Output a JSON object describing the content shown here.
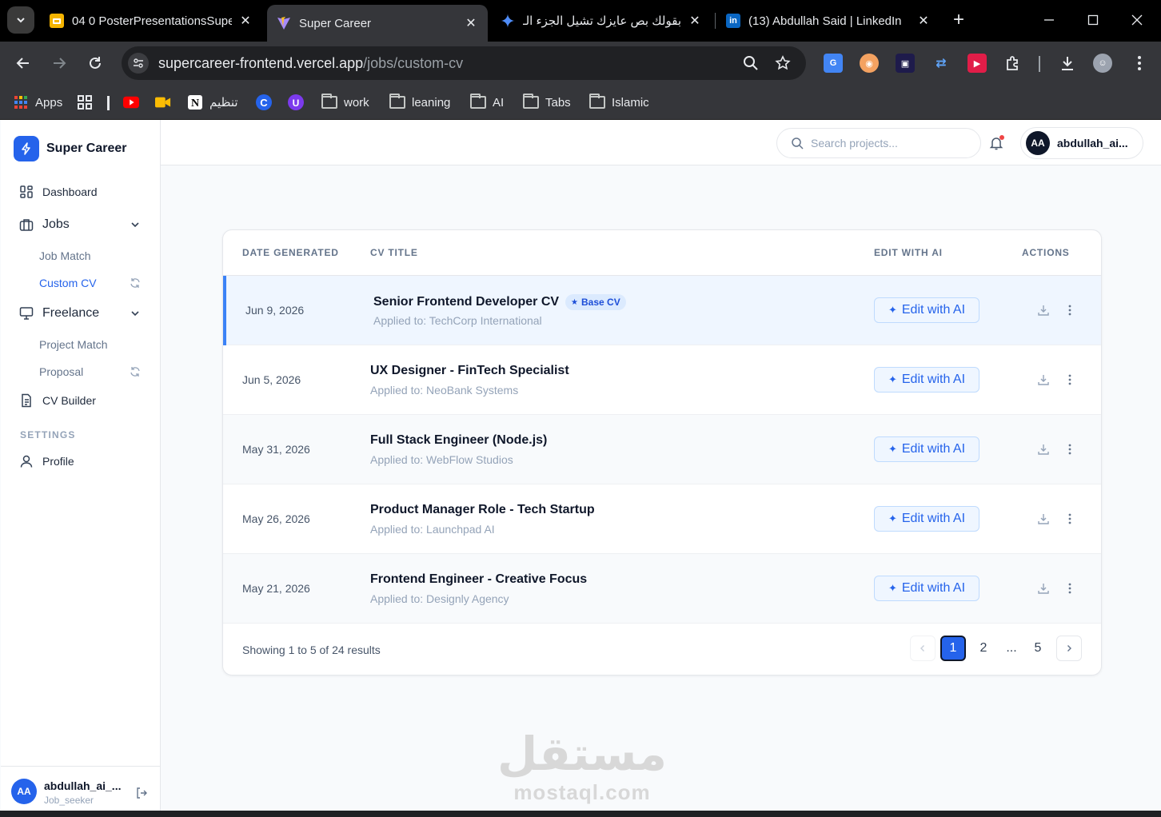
{
  "browser": {
    "tabs": [
      {
        "title": "04 0 PosterPresentationsSupe",
        "icon": "slides-icon"
      },
      {
        "title": "Super Career",
        "icon": "vite-icon",
        "active": true
      },
      {
        "title": "بقولك بص عايزك تشيل الجزء الـ",
        "icon": "gemini-icon"
      },
      {
        "title": "(13) Abdullah Said | LinkedIn",
        "icon": "linkedin-icon"
      }
    ],
    "url_host": "supercareer-frontend.vercel.app",
    "url_path": "/jobs/custom-cv",
    "bookmarks": [
      {
        "label": "Apps",
        "icon": "apps-grid-icon"
      },
      {
        "label": "",
        "icon": "youtube-icon"
      },
      {
        "label": "",
        "icon": "meet-icon"
      },
      {
        "label": "تنظيم",
        "icon": "notion-icon"
      },
      {
        "label": "",
        "icon": "c-app-icon"
      },
      {
        "label": "",
        "icon": "u-app-icon"
      },
      {
        "label": "work",
        "icon": "folder-icon"
      },
      {
        "label": "leaning",
        "icon": "folder-icon"
      },
      {
        "label": "AI",
        "icon": "folder-icon"
      },
      {
        "label": "Tabs",
        "icon": "folder-icon"
      },
      {
        "label": "Islamic",
        "icon": "folder-icon"
      }
    ]
  },
  "app": {
    "brand": "Super Career",
    "sidebar": {
      "dashboard": "Dashboard",
      "jobs": "Jobs",
      "job_match": "Job Match",
      "custom_cv": "Custom CV",
      "freelance": "Freelance",
      "project_match": "Project Match",
      "proposal": "Proposal",
      "cv_builder": "CV Builder",
      "settings_label": "SETTINGS",
      "profile": "Profile",
      "user": {
        "initials": "AA",
        "name": "abdullah_ai_...",
        "role": "Job_seeker"
      }
    },
    "header": {
      "search_placeholder": "Search projects...",
      "user_initials": "AA",
      "user_name": "abdullah_ai..."
    },
    "table": {
      "columns": {
        "date": "DATE GENERATED",
        "title": "CV TITLE",
        "edit": "EDIT WITH AI",
        "actions": "ACTIONS"
      },
      "edit_label": "Edit with AI",
      "base_badge": "Base CV",
      "rows": [
        {
          "date": "Jun 9, 2026",
          "title": "Senior Frontend Developer CV",
          "applied": "Applied to: TechCorp International",
          "base": true
        },
        {
          "date": "Jun 5, 2026",
          "title": "UX Designer - FinTech Specialist",
          "applied": "Applied to: NeoBank Systems"
        },
        {
          "date": "May 31, 2026",
          "title": "Full Stack Engineer (Node.js)",
          "applied": "Applied to: WebFlow Studios"
        },
        {
          "date": "May 26, 2026",
          "title": "Product Manager Role - Tech Startup",
          "applied": "Applied to: Launchpad AI"
        },
        {
          "date": "May 21, 2026",
          "title": "Frontend Engineer - Creative Focus",
          "applied": "Applied to: Designly Agency"
        }
      ]
    },
    "pagination": {
      "summary": "Showing 1 to 5 of 24 results",
      "pages": [
        "1",
        "2",
        "...",
        "5"
      ],
      "current": "1"
    },
    "watermark": {
      "arabic": "مستقل",
      "latin": "mostaql.com"
    }
  },
  "colors": {
    "accent": "#2563eb",
    "selected_row": "#eff6ff",
    "brand_dark": "#0f172a"
  }
}
